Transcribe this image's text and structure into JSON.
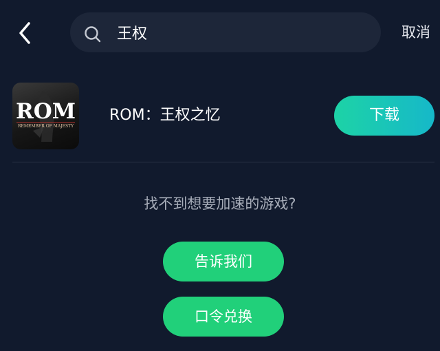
{
  "header": {
    "back_icon": "chevron-left-icon",
    "search": {
      "icon": "search-icon",
      "value": "王权",
      "placeholder": ""
    },
    "cancel_label": "取消"
  },
  "result": {
    "icon": {
      "logo_text": "ROM",
      "subtitle_text": "REMEMBER OF MAJESTY"
    },
    "title": "ROM：王权之忆",
    "download_label": "下载"
  },
  "help": {
    "prompt": "找不到想要加速的游戏?",
    "contact_label": "告诉我们",
    "redeem_label": "口令兑换"
  },
  "colors": {
    "background": "#111a2d",
    "search_bg": "#1d2639",
    "download_gradient_start": "#1dd3a6",
    "download_gradient_end": "#16b8c9",
    "action_green": "#21d07a",
    "prompt_text": "#a7adb9"
  }
}
